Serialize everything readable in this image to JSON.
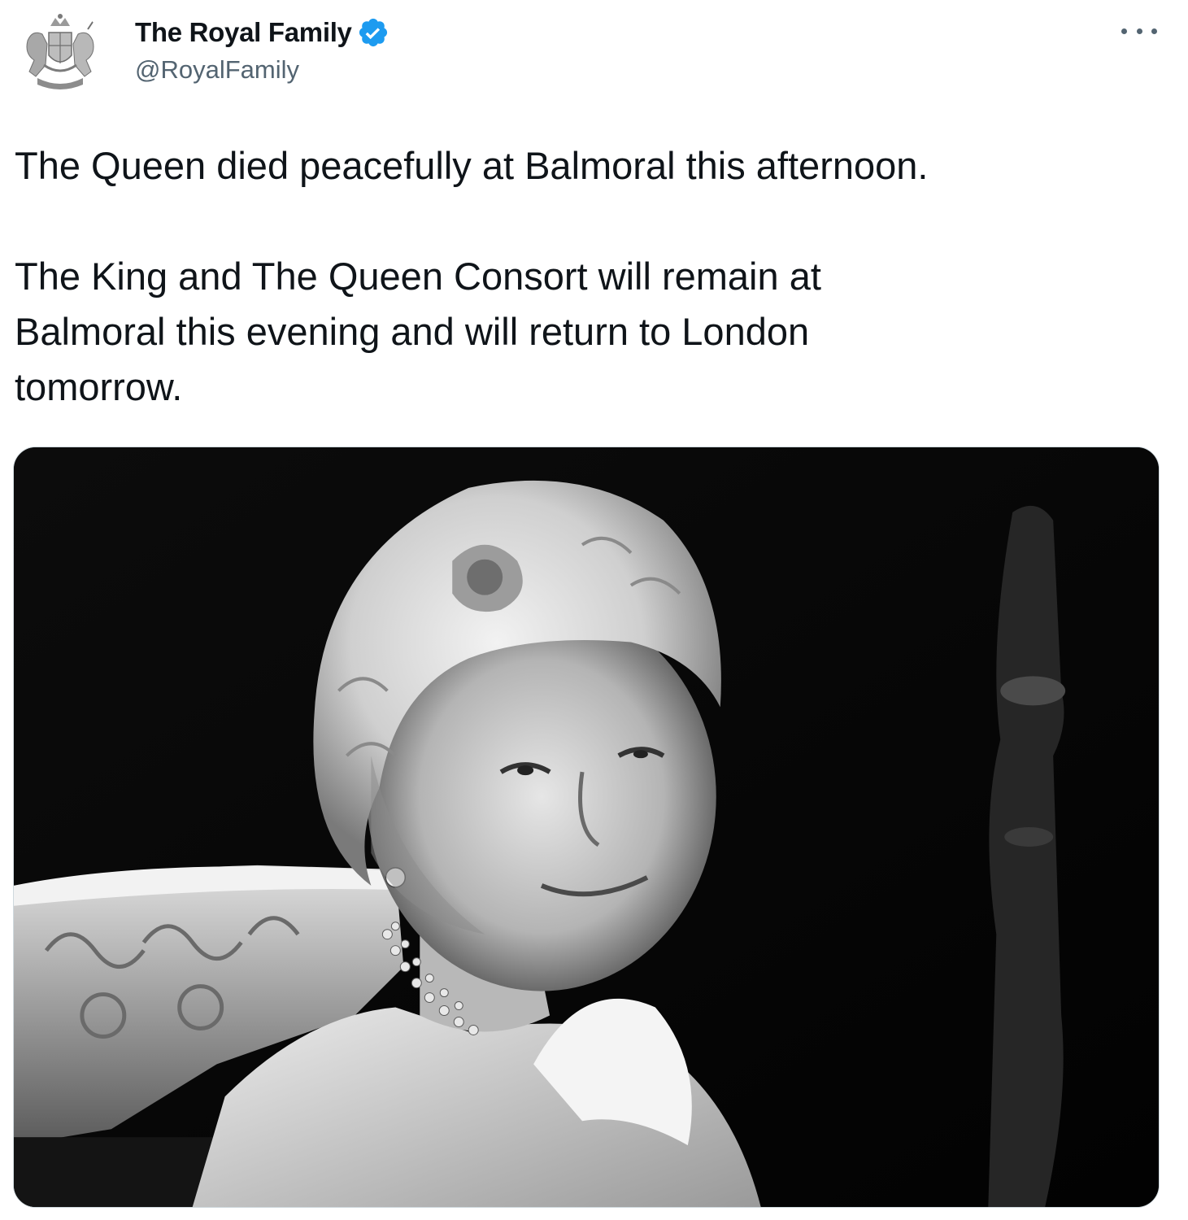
{
  "tweet": {
    "author": {
      "name": "The Royal Family",
      "handle": "@RoyalFamily",
      "avatar_icon": "royal-coat-of-arms-icon",
      "verified_icon": "verified-badge-icon",
      "verified_color": "#1d9bf0"
    },
    "more_icon": "more-options-icon",
    "text": {
      "paragraph1": "The Queen died peacefully at Balmoral this afternoon.",
      "paragraph2_line1": "The King and The Queen Consort will remain at",
      "paragraph2_line2": "Balmoral this evening and will return to London",
      "paragraph2_line3": "tomorrow."
    },
    "media": {
      "type": "photo",
      "style": "black-and-white portrait"
    }
  }
}
